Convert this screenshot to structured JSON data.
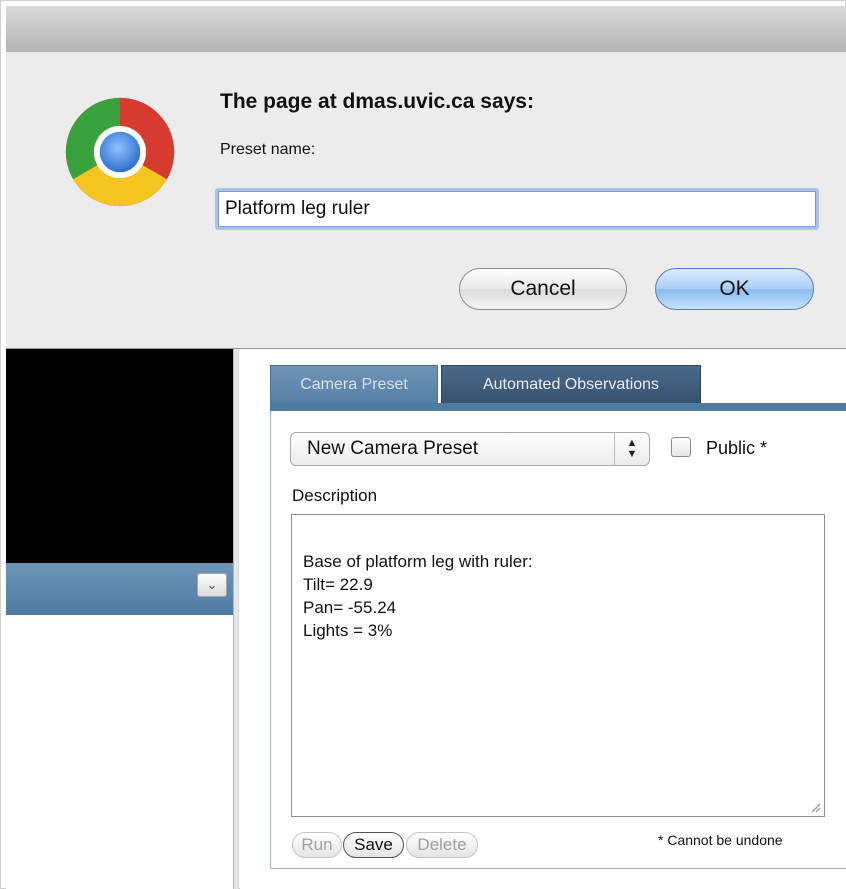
{
  "dialog": {
    "title": "The page at dmas.uvic.ca says:",
    "prompt_label": "Preset name:",
    "input_value": "Platform leg ruler",
    "cancel_label": "Cancel",
    "ok_label": "OK"
  },
  "tabs": [
    {
      "label": "Camera Preset",
      "active": true
    },
    {
      "label": "Automated Observations",
      "active": false
    }
  ],
  "preset_form": {
    "select_value": "New Camera Preset",
    "public_label": "Public *",
    "public_checked": false,
    "description_label": "Description",
    "description_text": "Base of platform leg with ruler:\nTilt= 22.9\nPan= -55.24\nLights = 3%",
    "buttons": {
      "run": "Run",
      "save": "Save",
      "delete": "Delete"
    },
    "note": "* Cannot be undone"
  },
  "colors": {
    "accent_blue": "#4f7aa1",
    "tab_active": "#5680a6",
    "tab_inactive": "#36526f",
    "ok_button": "#a9cff5"
  },
  "icons": {
    "logo": "chrome-logo-icon",
    "dropdown": "chevron-down-icon",
    "stepper": "up-down-arrows-icon"
  }
}
